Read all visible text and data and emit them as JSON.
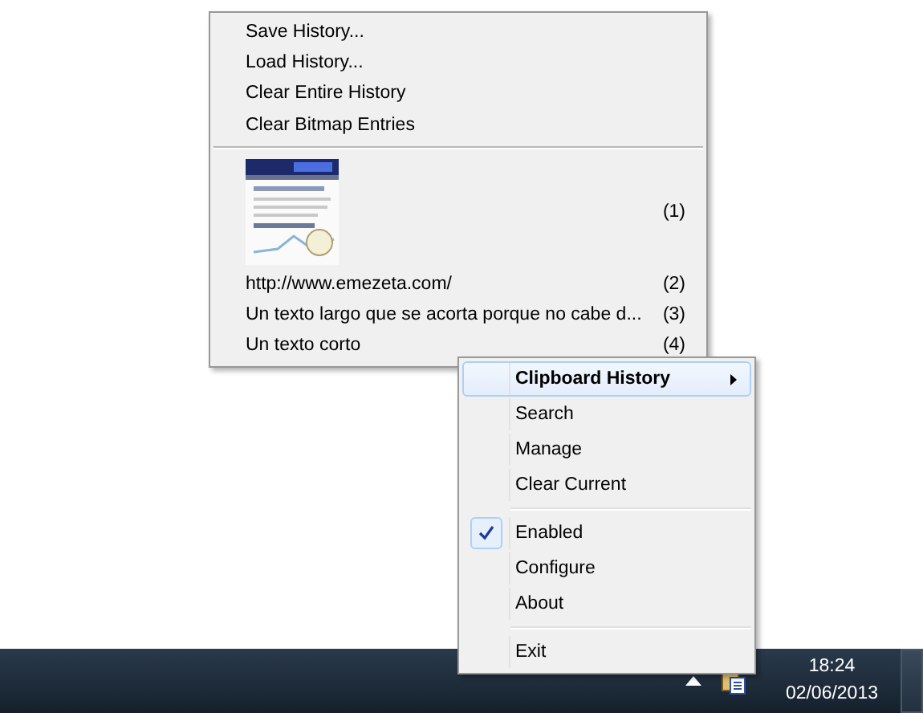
{
  "history_menu": {
    "commands": [
      {
        "label": "Save History..."
      },
      {
        "label": "Load History..."
      },
      {
        "label": "Clear Entire History"
      },
      {
        "label": "Clear Bitmap Entries"
      }
    ],
    "entries": [
      {
        "kind": "picture",
        "shortcut": "(1)"
      },
      {
        "kind": "text",
        "label": "http://www.emezeta.com/",
        "shortcut": "(2)"
      },
      {
        "kind": "text",
        "label": "Un texto largo que se acorta porque no cabe d...",
        "shortcut": "(3)"
      },
      {
        "kind": "text",
        "label": "Un texto corto",
        "shortcut": "(4)"
      }
    ]
  },
  "tray_menu": {
    "items": [
      {
        "kind": "submenu",
        "label": "Clipboard History",
        "selected": true,
        "checked": false
      },
      {
        "kind": "command",
        "label": "Search",
        "selected": false,
        "checked": false
      },
      {
        "kind": "command",
        "label": "Manage",
        "selected": false,
        "checked": false
      },
      {
        "kind": "command",
        "label": "Clear Current",
        "selected": false,
        "checked": false
      },
      {
        "kind": "separator"
      },
      {
        "kind": "command",
        "label": "Enabled",
        "selected": false,
        "checked": true
      },
      {
        "kind": "command",
        "label": "Configure",
        "selected": false,
        "checked": false
      },
      {
        "kind": "command",
        "label": "About",
        "selected": false,
        "checked": false
      },
      {
        "kind": "separator"
      },
      {
        "kind": "command",
        "label": "Exit",
        "selected": false,
        "checked": false
      }
    ]
  },
  "taskbar": {
    "time": "18:24",
    "date": "02/06/2013"
  }
}
